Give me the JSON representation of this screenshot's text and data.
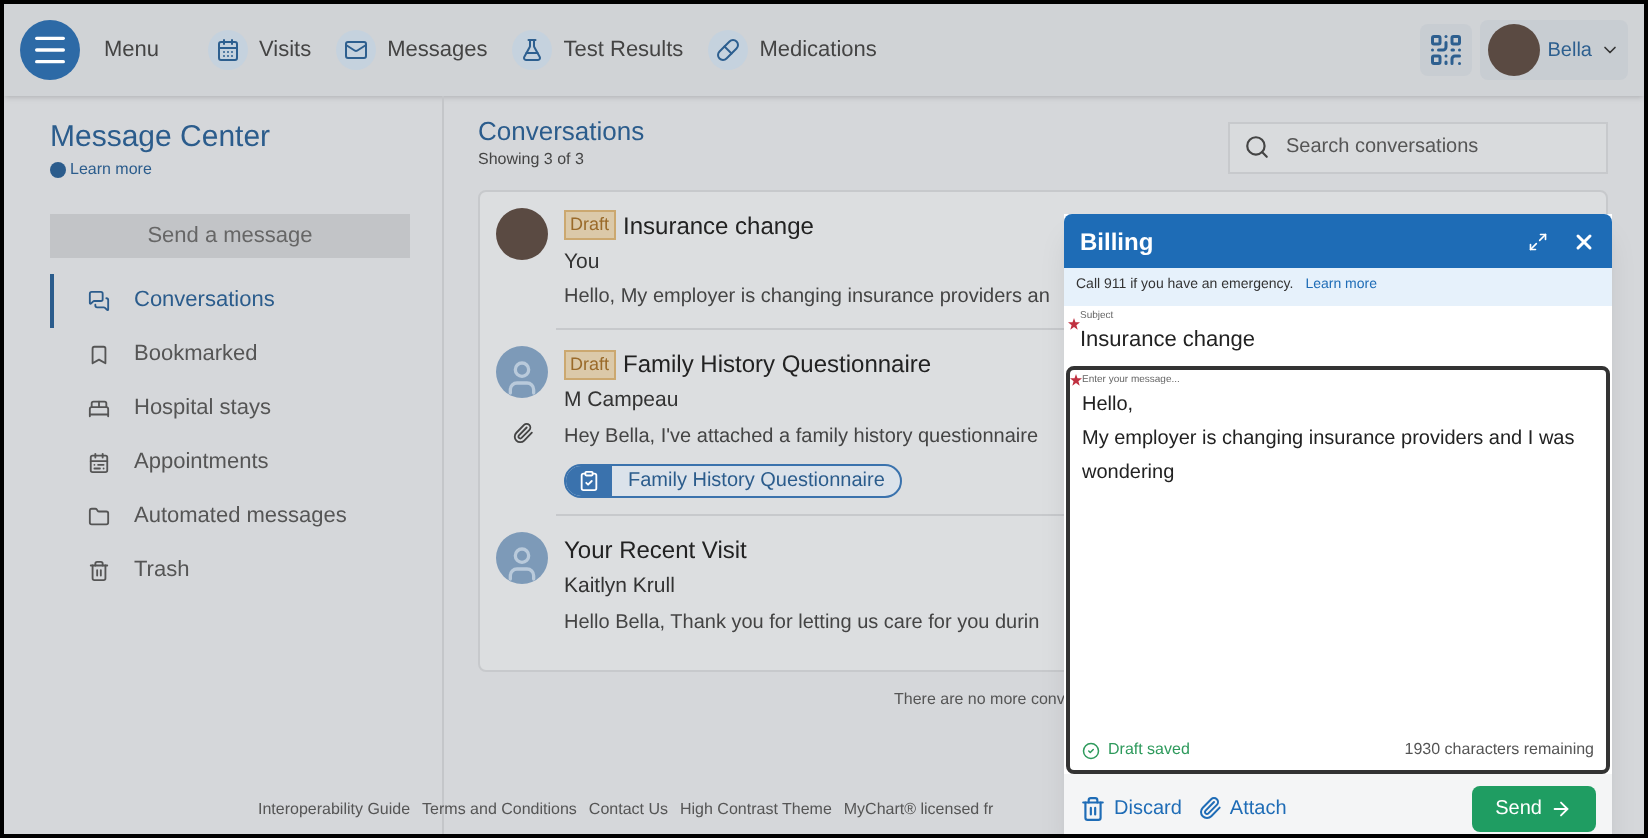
{
  "nav": {
    "menu_label": "Menu",
    "items": [
      {
        "label": "Visits"
      },
      {
        "label": "Messages"
      },
      {
        "label": "Test Results"
      },
      {
        "label": "Medications"
      }
    ],
    "user": "Bella"
  },
  "sidebar": {
    "title": "Message Center",
    "learn_more": "Learn more",
    "send_button": "Send a message",
    "items": [
      {
        "label": "Conversations",
        "selected": true
      },
      {
        "label": "Bookmarked",
        "selected": false
      },
      {
        "label": "Hospital stays",
        "selected": false
      },
      {
        "label": "Appointments",
        "selected": false
      },
      {
        "label": "Automated messages",
        "selected": false
      },
      {
        "label": "Trash",
        "selected": false
      }
    ]
  },
  "conversations": {
    "title": "Conversations",
    "count": "Showing 3 of 3",
    "search": {
      "placeholder": "Search conversations"
    },
    "items": [
      {
        "kind": "photo",
        "title": "Insurance change",
        "draft": true,
        "draft_label": "Draft",
        "sender": "You",
        "preview": "Hello, My employer is changing insurance providers an"
      },
      {
        "kind": "generic",
        "title": "Family History Questionnaire",
        "draft": true,
        "draft_label": "Draft",
        "sender": "M Campeau",
        "preview": "Hey Bella,  I've attached a family history questionnaire",
        "attachment": "Family History Questionnaire"
      },
      {
        "kind": "generic",
        "title": "Your Recent Visit",
        "draft": false,
        "sender": "Kaitlyn Krull",
        "preview": "Hello Bella,  Thank you for letting us care for you durin"
      }
    ],
    "end_note": "There are no more conv"
  },
  "footer_links": [
    "Interoperability Guide",
    "Terms and Conditions",
    "Contact Us",
    "High Contrast Theme",
    "MyChart® licensed fr"
  ],
  "dialog": {
    "title": "Billing",
    "notice": "Call 911 if you have an emergency.",
    "notice_link": "Learn more",
    "subject": {
      "label": "Subject",
      "value": "Insurance change",
      "required": true
    },
    "message": {
      "placeholder": "Enter your message...",
      "required": true,
      "value": "Hello,\nMy employer is changing insurance providers and I was wondering"
    },
    "status": "Draft saved",
    "remaining": "1930 characters remaining",
    "discard": "Discard",
    "attach": "Attach",
    "send": "Send"
  }
}
